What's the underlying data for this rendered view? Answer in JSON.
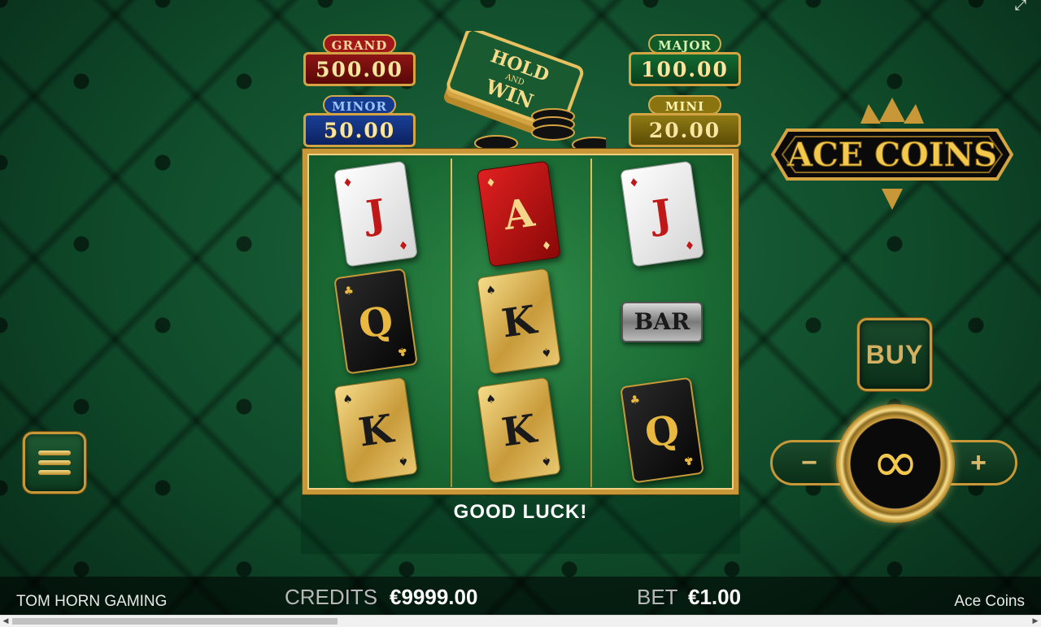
{
  "jackpots": {
    "grand": {
      "label": "GRAND",
      "value": "500.00"
    },
    "minor": {
      "label": "MINOR",
      "value": "50.00"
    },
    "major": {
      "label": "MAJOR",
      "value": "100.00"
    },
    "mini": {
      "label": "MINI",
      "value": "20.00"
    }
  },
  "hold_and_win_logo": {
    "line1": "HOLD",
    "line2": "AND",
    "line3": "WIN"
  },
  "game_logo": "ACE COINS",
  "reels": [
    [
      {
        "rank": "J",
        "style": "white",
        "suit": "♦"
      },
      {
        "rank": "Q",
        "style": "black",
        "suit": "♣"
      },
      {
        "rank": "K",
        "style": "gold",
        "suit": "♠"
      }
    ],
    [
      {
        "rank": "A",
        "style": "red",
        "suit": "♦"
      },
      {
        "rank": "K",
        "style": "gold",
        "suit": "♠"
      },
      {
        "rank": "K",
        "style": "gold",
        "suit": "♠"
      }
    ],
    [
      {
        "rank": "J",
        "style": "white",
        "suit": "♦"
      },
      {
        "rank": "BAR",
        "style": "bar",
        "suit": ""
      },
      {
        "rank": "Q",
        "style": "black",
        "suit": "♣"
      }
    ]
  ],
  "message": "GOOD LUCK!",
  "controls": {
    "buy_label": "BUY",
    "minus_label": "−",
    "plus_label": "+",
    "spin_icon": "infinity-icon",
    "menu_icon": "hamburger-menu-icon",
    "fullscreen_icon": "expand-icon"
  },
  "footer": {
    "brand": "TOM HORN GAMING",
    "credits_label": "CREDITS",
    "credits_value": "€9999.00",
    "bet_label": "BET",
    "bet_value": "€1.00",
    "game_name": "Ace Coins"
  },
  "colors": {
    "felt": "#1a6a34",
    "gold": "#c89838",
    "grand": "#a01818",
    "minor": "#143a8e",
    "major": "#0f5a26",
    "mini": "#8a7410"
  }
}
